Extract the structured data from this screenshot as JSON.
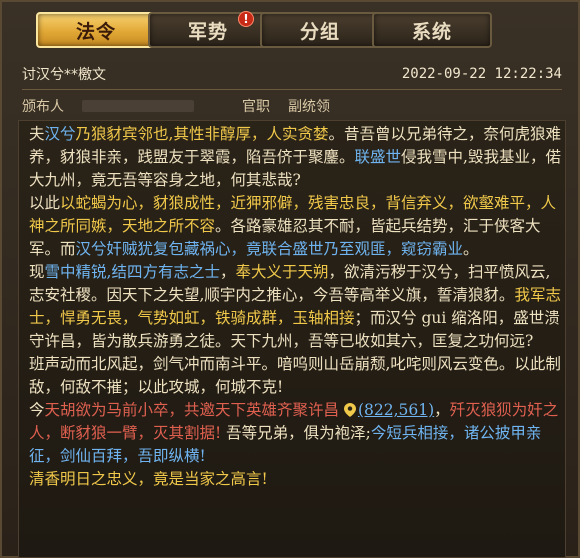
{
  "tabs": [
    {
      "label": "法令",
      "active": true
    },
    {
      "label": "军势",
      "badge": "!"
    },
    {
      "label": "分组"
    },
    {
      "label": "系统"
    }
  ],
  "header": {
    "title": "讨汉兮**檄文",
    "datetime": "2022-09-22 12:22:34"
  },
  "meta": {
    "issuer_label": "颁布人",
    "role_label": "官职",
    "role_value": "副统领"
  },
  "colors": {
    "gold": "#f0c84a",
    "blue": "#6fb4f0",
    "red": "#e06050"
  },
  "decree": {
    "p1": [
      {
        "t": "夫",
        "c": ""
      },
      {
        "t": "汉兮",
        "c": "b"
      },
      {
        "t": "乃狼豺宾邻也,其性非醇厚，人实贪婪",
        "c": "y"
      },
      {
        "t": "。昔吾曾以兄弟待之，奈何虎狼难养，豺狼非亲，践盟友于翠霞，陷吾侪于聚鏖。",
        "c": ""
      },
      {
        "t": "联盛世",
        "c": "b"
      },
      {
        "t": "侵我雪中,毁我基业，偌大九州，竟无吾等容身之地，何其悲哉?",
        "c": ""
      }
    ],
    "p2": [
      {
        "t": "  以此",
        "c": ""
      },
      {
        "t": "以蛇蝎为心，豺狼成性，近狎邪僻，残害忠良，背信弃义，欲壑难平，人神之所同嫉，天地之所不容",
        "c": "y"
      },
      {
        "t": "。各路豪雄忍其不耐，皆起兵结势，汇于侠客大军。而",
        "c": ""
      },
      {
        "t": "汉兮奸贼犹复包藏祸心，竟联合盛世乃至观匪，窥窃霸业",
        "c": "b"
      },
      {
        "t": "。",
        "c": ""
      }
    ],
    "p3": [
      {
        "t": "  现",
        "c": ""
      },
      {
        "t": "雪中精锐,结四方有志之士",
        "c": "b"
      },
      {
        "t": "，",
        "c": ""
      },
      {
        "t": "奉大义于天朔",
        "c": "y"
      },
      {
        "t": "，欲清污秽于汉兮，扫平愤风云,志安社稷。因天下之失望,顺宇内之推心，今吾等高举义旗，誓清狼豺。",
        "c": ""
      },
      {
        "t": "我军志士，悍勇无畏，气势如虹，铁骑成群，玉轴相接",
        "c": "y"
      },
      {
        "t": "；而汉兮 gui 缩洛阳，盛世溃守许昌，皆为散兵游勇之徒。天下九州，吾等已收如其六，匡复之功何远?",
        "c": ""
      }
    ],
    "p4": [
      {
        "t": "  班声动而北风起，剑气冲而南斗平。喑呜则山岳崩颓,叱咤则风云变色。以此制敌，何敌不摧；以此攻城，何城不克!",
        "c": ""
      }
    ],
    "p5_pre": [
      {
        "t": "    今",
        "c": ""
      },
      {
        "t": "天胡欲为马前小卒，共邀天下英雄齐聚许昌",
        "c": "r"
      },
      {
        "t": " ",
        "c": ""
      }
    ],
    "coord": "(822,561)",
    "p5_post": [
      {
        "t": "，",
        "c": ""
      },
      {
        "t": "歼灭狼狈为奸之人，断豺狼一臂，灭其割据!",
        "c": "r"
      },
      {
        "t": " 吾等兄弟，俱为袍泽;",
        "c": ""
      },
      {
        "t": "今短兵相接，诸公披甲亲征，剑仙百拜，吾即纵横!",
        "c": "b"
      }
    ],
    "p6": [
      {
        "t": "    清香明日之忠义，竟是当家之高言!",
        "c": "y"
      }
    ]
  }
}
